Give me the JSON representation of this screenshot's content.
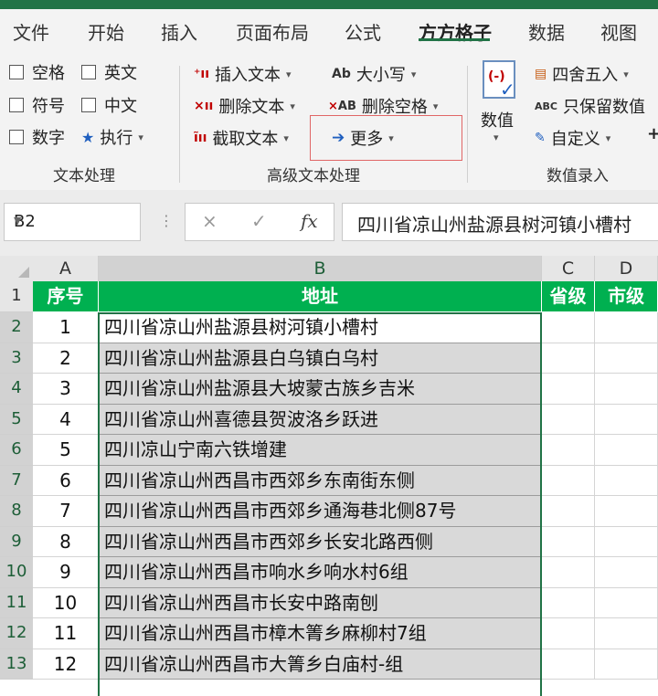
{
  "tabs": [
    "文件",
    "开始",
    "插入",
    "页面布局",
    "公式",
    "方方格子",
    "数据",
    "视图"
  ],
  "ribbon": {
    "checkboxes": [
      "空格",
      "英文",
      "符号",
      "中文",
      "数字"
    ],
    "execute": "执行",
    "insert_text": "插入文本",
    "delete_text": "删除文本",
    "extract_text": "截取文本",
    "case": "大小写",
    "delete_space": "删除空格",
    "more": "更多",
    "numeric": "数值",
    "round": "四舍五入",
    "keep_numeric": "只保留数值",
    "custom": "自定义",
    "plus": "+",
    "groups": {
      "text_processing": "文本处理",
      "advanced_text": "高级文本处理",
      "value_entry": "数值录入"
    },
    "icons": {
      "execute": "star-icon",
      "insert": "insert-text-icon",
      "delete": "delete-text-icon",
      "extract": "extract-text-icon",
      "case_icon_text": "Ab",
      "delete_space_icon_text": "AB",
      "more_icon": "arrow-right-icon",
      "keep_numeric_icon_text": "ABC"
    }
  },
  "formula_bar": {
    "name_box": "B2",
    "cancel": "×",
    "confirm": "✓",
    "fx": "fx",
    "content": "四川省凉山州盐源县树河镇小槽村"
  },
  "sheet": {
    "columns": [
      "A",
      "B",
      "C",
      "D"
    ],
    "header_row": {
      "A": "序号",
      "B": "地址",
      "C": "省级",
      "D": "市级"
    },
    "rows": [
      {
        "rownum": "1"
      },
      {
        "rownum": "2",
        "no": "1",
        "addr": "四川省凉山州盐源县树河镇小槽村"
      },
      {
        "rownum": "3",
        "no": "2",
        "addr": "四川省凉山州盐源县白乌镇白乌村"
      },
      {
        "rownum": "4",
        "no": "3",
        "addr": "四川省凉山州盐源县大坡蒙古族乡吉米"
      },
      {
        "rownum": "5",
        "no": "4",
        "addr": "四川省凉山州喜德县贺波洛乡跃进"
      },
      {
        "rownum": "6",
        "no": "5",
        "addr": "四川凉山宁南六铁增建"
      },
      {
        "rownum": "7",
        "no": "6",
        "addr": "四川省凉山州西昌市西郊乡东南街东侧"
      },
      {
        "rownum": "8",
        "no": "7",
        "addr": "四川省凉山州西昌市西郊乡通海巷北侧87号"
      },
      {
        "rownum": "9",
        "no": "8",
        "addr": "四川省凉山州西昌市西郊乡长安北路西侧"
      },
      {
        "rownum": "10",
        "no": "9",
        "addr": "四川省凉山州西昌市响水乡响水村6组"
      },
      {
        "rownum": "11",
        "no": "10",
        "addr": "四川省凉山州西昌市长安中路南刨"
      },
      {
        "rownum": "12",
        "no": "11",
        "addr": "四川省凉山州西昌市樟木箐乡麻柳村7组"
      },
      {
        "rownum": "13",
        "no": "12",
        "addr": "四川省凉山州西昌市大箐乡白庙村-组"
      }
    ]
  },
  "colors": {
    "excel_green": "#217346",
    "header_fill": "#00b050",
    "selection_gray": "#d9d9d9",
    "highlight_red": "#e06666"
  }
}
